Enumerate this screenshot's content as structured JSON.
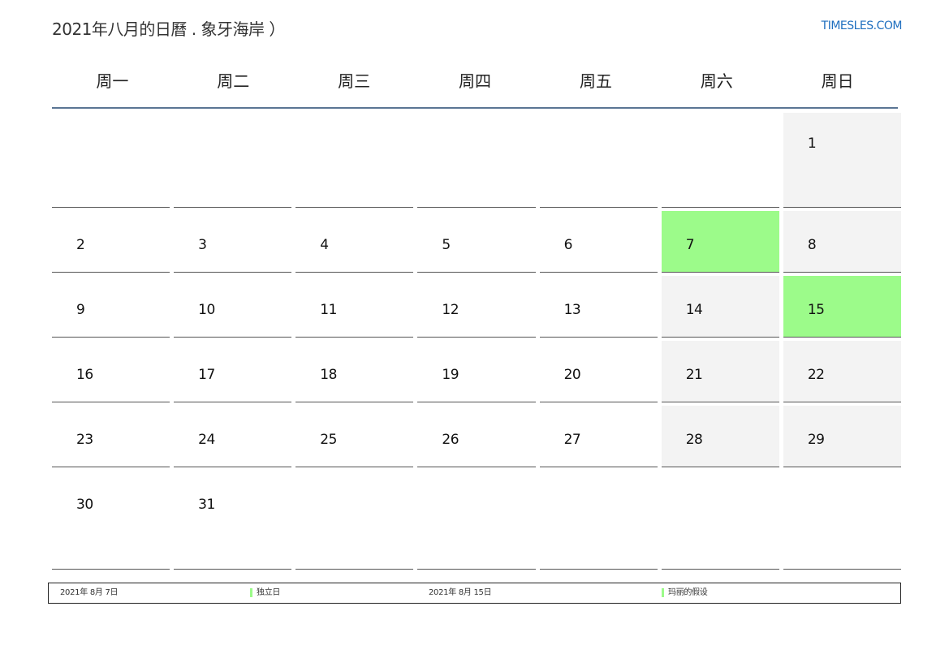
{
  "header": {
    "title": "2021年八月的日曆 . 象牙海岸 ）",
    "site": "TIMESLES.COM"
  },
  "weekdays": [
    "周一",
    "周二",
    "周三",
    "周四",
    "周五",
    "周六",
    "周日"
  ],
  "colors": {
    "holiday": "#9cfb8a",
    "weekend": "#f3f3f3",
    "header_rule": "#5a7594",
    "site_link": "#1f6fbf"
  },
  "calendar": {
    "year": 2021,
    "month": 8,
    "days": [
      "",
      "",
      "",
      "",
      "",
      "",
      "1",
      "2",
      "3",
      "4",
      "5",
      "6",
      "7",
      "8",
      "9",
      "10",
      "11",
      "12",
      "13",
      "14",
      "15",
      "16",
      "17",
      "18",
      "19",
      "20",
      "21",
      "22",
      "23",
      "24",
      "25",
      "26",
      "27",
      "28",
      "29",
      "30",
      "31",
      "",
      "",
      "",
      "",
      ""
    ],
    "holiday_days": [
      "7",
      "15"
    ]
  },
  "legend": [
    {
      "date": "2021年 8月 7日",
      "name": "独立日"
    },
    {
      "date": "2021年 8月 15日",
      "name": "玛丽的假设"
    }
  ]
}
